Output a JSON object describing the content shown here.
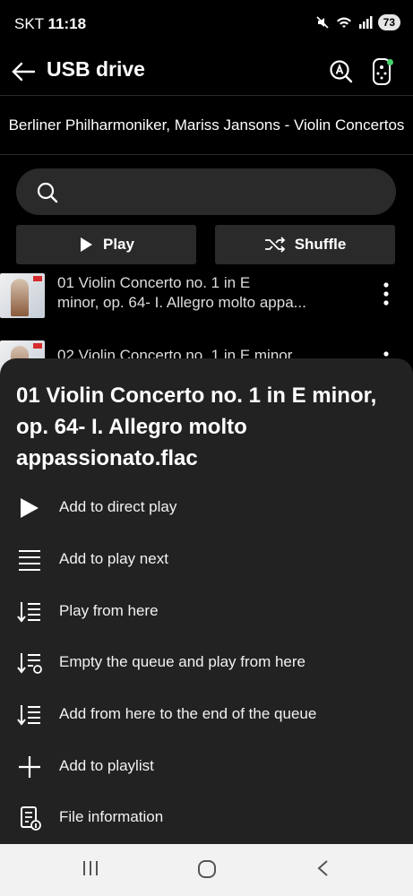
{
  "status": {
    "carrier": "SKT",
    "time": "11:18",
    "battery": "73"
  },
  "appbar": {
    "title": "USB drive"
  },
  "album": {
    "title": "Berliner Philharmoniker, Mariss Jansons - Violin Concertos"
  },
  "search": {
    "placeholder": ""
  },
  "actions": {
    "play_label": "Play",
    "shuffle_label": "Shuffle"
  },
  "tracks": [
    {
      "title_line1": "01 Violin Concerto no. 1 in E",
      "title_line2": "minor, op. 64- I. Allegro molto appa..."
    },
    {
      "title_line1": "02 Violin Concerto no. 1 in E minor",
      "title_line2": ""
    }
  ],
  "sheet": {
    "title": "01 Violin Concerto no. 1 in E minor, op. 64- I. Allegro molto appassionato.flac",
    "items": [
      {
        "label": "Add to direct play",
        "icon": "play-icon"
      },
      {
        "label": "Add to play next",
        "icon": "play-next-icon"
      },
      {
        "label": "Play from here",
        "icon": "play-from-here-icon"
      },
      {
        "label": "Empty the queue and play from here",
        "icon": "empty-queue-icon"
      },
      {
        "label": "Add from here to the end of the queue",
        "icon": "add-to-queue-end-icon"
      },
      {
        "label": "Add to playlist",
        "icon": "plus-icon"
      },
      {
        "label": "File information",
        "icon": "file-info-icon"
      }
    ]
  },
  "colors": {
    "background": "#000000",
    "surface": "#2a2a2a",
    "sheet": "#222222",
    "accent_dot": "#44d26b"
  }
}
